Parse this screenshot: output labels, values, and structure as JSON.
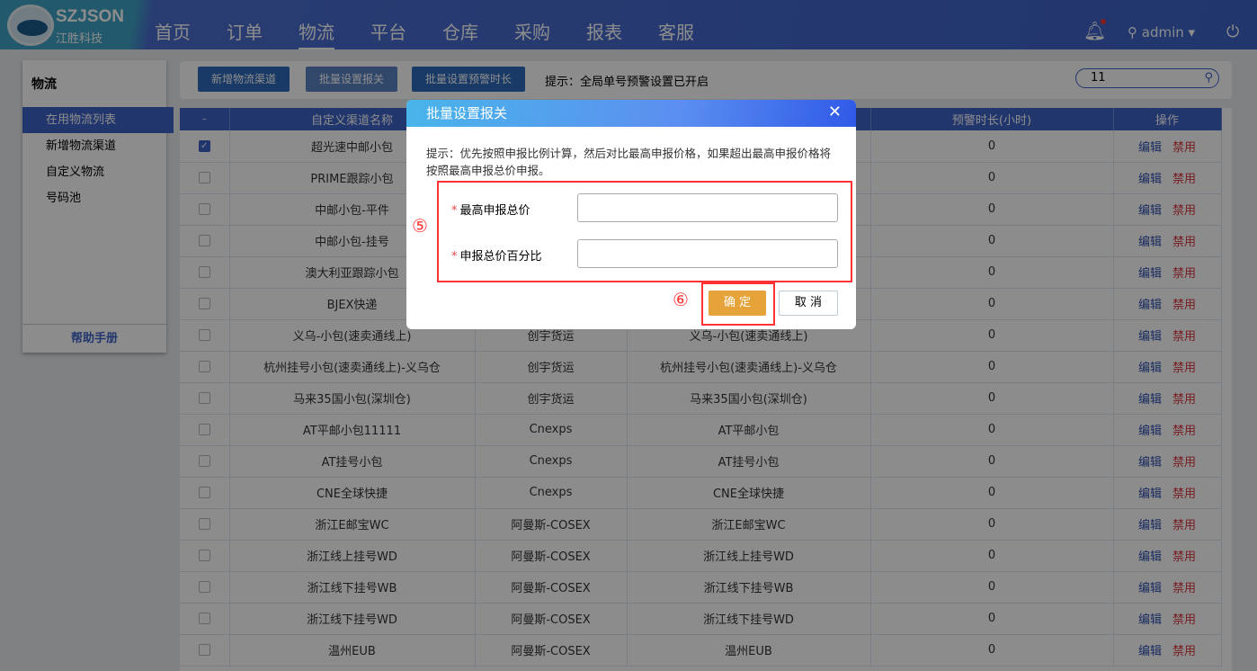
{
  "header": {
    "brand": "SZJSON",
    "brand_cn": "江胜科技",
    "nav": [
      "首页",
      "订单",
      "物流",
      "平台",
      "仓库",
      "采购",
      "报表",
      "客服"
    ],
    "active": "物流",
    "user": "admin"
  },
  "sidebar": {
    "title": "物流",
    "items": [
      "在用物流列表",
      "新增物流渠道",
      "自定义物流",
      "号码池"
    ],
    "help": "帮助手册"
  },
  "toolbar": {
    "add": "新增物流渠道",
    "batch_customs": "批量设置报关",
    "batch_warn": "批量设置预警时长",
    "tip": "提示：全局单号预警设置已开启",
    "search_value": "11"
  },
  "table": {
    "headers": [
      "自定义渠道名称",
      "",
      "",
      "预警时长(小时)",
      "操作"
    ],
    "edit": "编辑",
    "disable": "禁用",
    "rows": [
      [
        "超光速中邮小包",
        "",
        "",
        "0",
        true
      ],
      [
        "PRIME跟踪小包",
        "",
        "",
        "0",
        false
      ],
      [
        "中邮小包-平件",
        "",
        "",
        "0",
        false
      ],
      [
        "中邮小包-挂号",
        "",
        "",
        "0",
        false
      ],
      [
        "澳大利亚跟踪小包",
        "",
        "",
        "0",
        false
      ],
      [
        "BJEX快递",
        "",
        "",
        "0",
        false
      ],
      [
        "义乌-小包(速卖通线上)",
        "创宇货运",
        "义乌-小包(速卖通线上)",
        "0",
        false
      ],
      [
        "杭州挂号小包(速卖通线上)-义乌仓",
        "创宇货运",
        "杭州挂号小包(速卖通线上)-义乌仓",
        "0",
        false
      ],
      [
        "马来35国小包(深圳仓)",
        "创宇货运",
        "马来35国小包(深圳仓)",
        "0",
        false
      ],
      [
        "AT平邮小包11111",
        "Cnexps",
        "AT平邮小包",
        "0",
        false
      ],
      [
        "AT挂号小包",
        "Cnexps",
        "AT挂号小包",
        "0",
        false
      ],
      [
        "CNE全球快捷",
        "Cnexps",
        "CNE全球快捷",
        "0",
        false
      ],
      [
        "浙江E邮宝WC",
        "阿曼斯-COSEX",
        "浙江E邮宝WC",
        "0",
        false
      ],
      [
        "浙江线上挂号WD",
        "阿曼斯-COSEX",
        "浙江线上挂号WD",
        "0",
        false
      ],
      [
        "浙江线下挂号WB",
        "阿曼斯-COSEX",
        "浙江线下挂号WB",
        "0",
        false
      ],
      [
        "浙江线下挂号WD",
        "阿曼斯-COSEX",
        "浙江线下挂号WD",
        "0",
        false
      ],
      [
        "温州EUB",
        "阿曼斯-COSEX",
        "温州EUB",
        "0",
        false
      ]
    ]
  },
  "modal": {
    "title": "批量设置报关",
    "tip": "提示：优先按照申报比例计算，然后对比最高申报价格，如果超出最高申报价格将按照最高申报总价申报。",
    "field1": "最高申报总价",
    "field2": "申报总价百分比",
    "required": "*",
    "ok": "确 定",
    "cancel": "取 消",
    "mark5": "⑤",
    "mark6": "⑥"
  }
}
